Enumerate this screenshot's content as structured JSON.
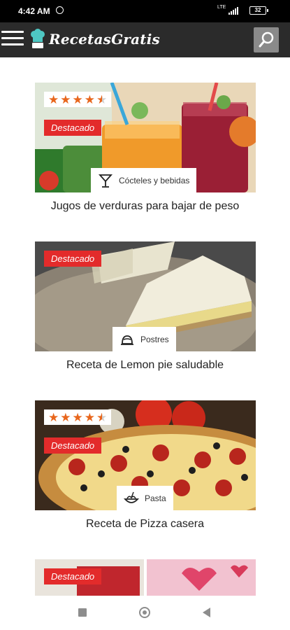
{
  "status": {
    "time": "4:42 AM",
    "network": "LTE",
    "battery": "32"
  },
  "app": {
    "brand": "RecetasGratis",
    "menu_icon": "menu-icon",
    "search_icon": "search-icon"
  },
  "recipes": [
    {
      "title": "Jugos de verduras para bajar de peso",
      "badge": "Destacado",
      "category": "Cócteles y bebidas",
      "category_icon": "cocktail-icon",
      "rating": 4.5
    },
    {
      "title": "Receta de Lemon pie saludable",
      "badge": "Destacado",
      "category": "Postres",
      "category_icon": "pudding-icon"
    },
    {
      "title": "Receta de Pizza casera",
      "badge": "Destacado",
      "category": "Pasta",
      "category_icon": "pasta-icon",
      "rating": 4.5
    },
    {
      "badge": "Destacado"
    }
  ],
  "colors": {
    "appbar": "#2b2b2b",
    "badge": "#e32b2b",
    "star": "#e8661c",
    "search_button": "#8a8a8a"
  }
}
